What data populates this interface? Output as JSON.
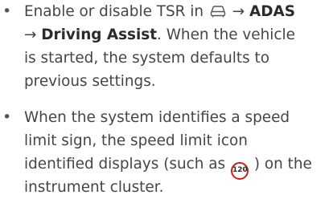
{
  "bullets": [
    {
      "lines": {
        "l1_pre": "Enable or disable TSR in",
        "l1_arrow": " → ",
        "l1_bold": "ADAS",
        "l2_arrow": "→ ",
        "l2_bold": "Driving Assist",
        "l2_post": ". When the vehicle",
        "l3": "is started, the system defaults to",
        "l4": "previous settings."
      },
      "icon": "car-icon"
    },
    {
      "lines": {
        "l1": "When the system identifies a speed",
        "l2": "limit sign, the speed limit icon",
        "l3_pre": "identified displays (such as",
        "l3_post": ") on the",
        "l4": "instrument cluster."
      },
      "icon": "speed-limit-sign-icon",
      "badge_text": "120",
      "badge_color": "#d21a1a"
    }
  ],
  "bullet_glyph": "•"
}
